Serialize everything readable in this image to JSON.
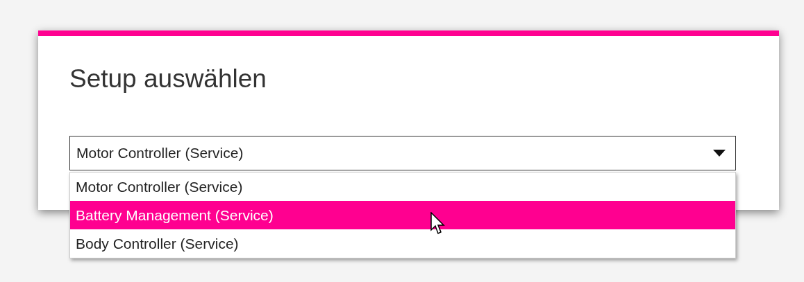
{
  "dialog": {
    "title": "Setup auswählen"
  },
  "select": {
    "value": "Motor Controller (Service)",
    "expanded": true,
    "options": [
      {
        "label": "Motor Controller (Service)",
        "highlighted": false
      },
      {
        "label": "Battery Management (Service)",
        "highlighted": true
      },
      {
        "label": "Body Controller (Service)",
        "highlighted": false
      }
    ]
  }
}
